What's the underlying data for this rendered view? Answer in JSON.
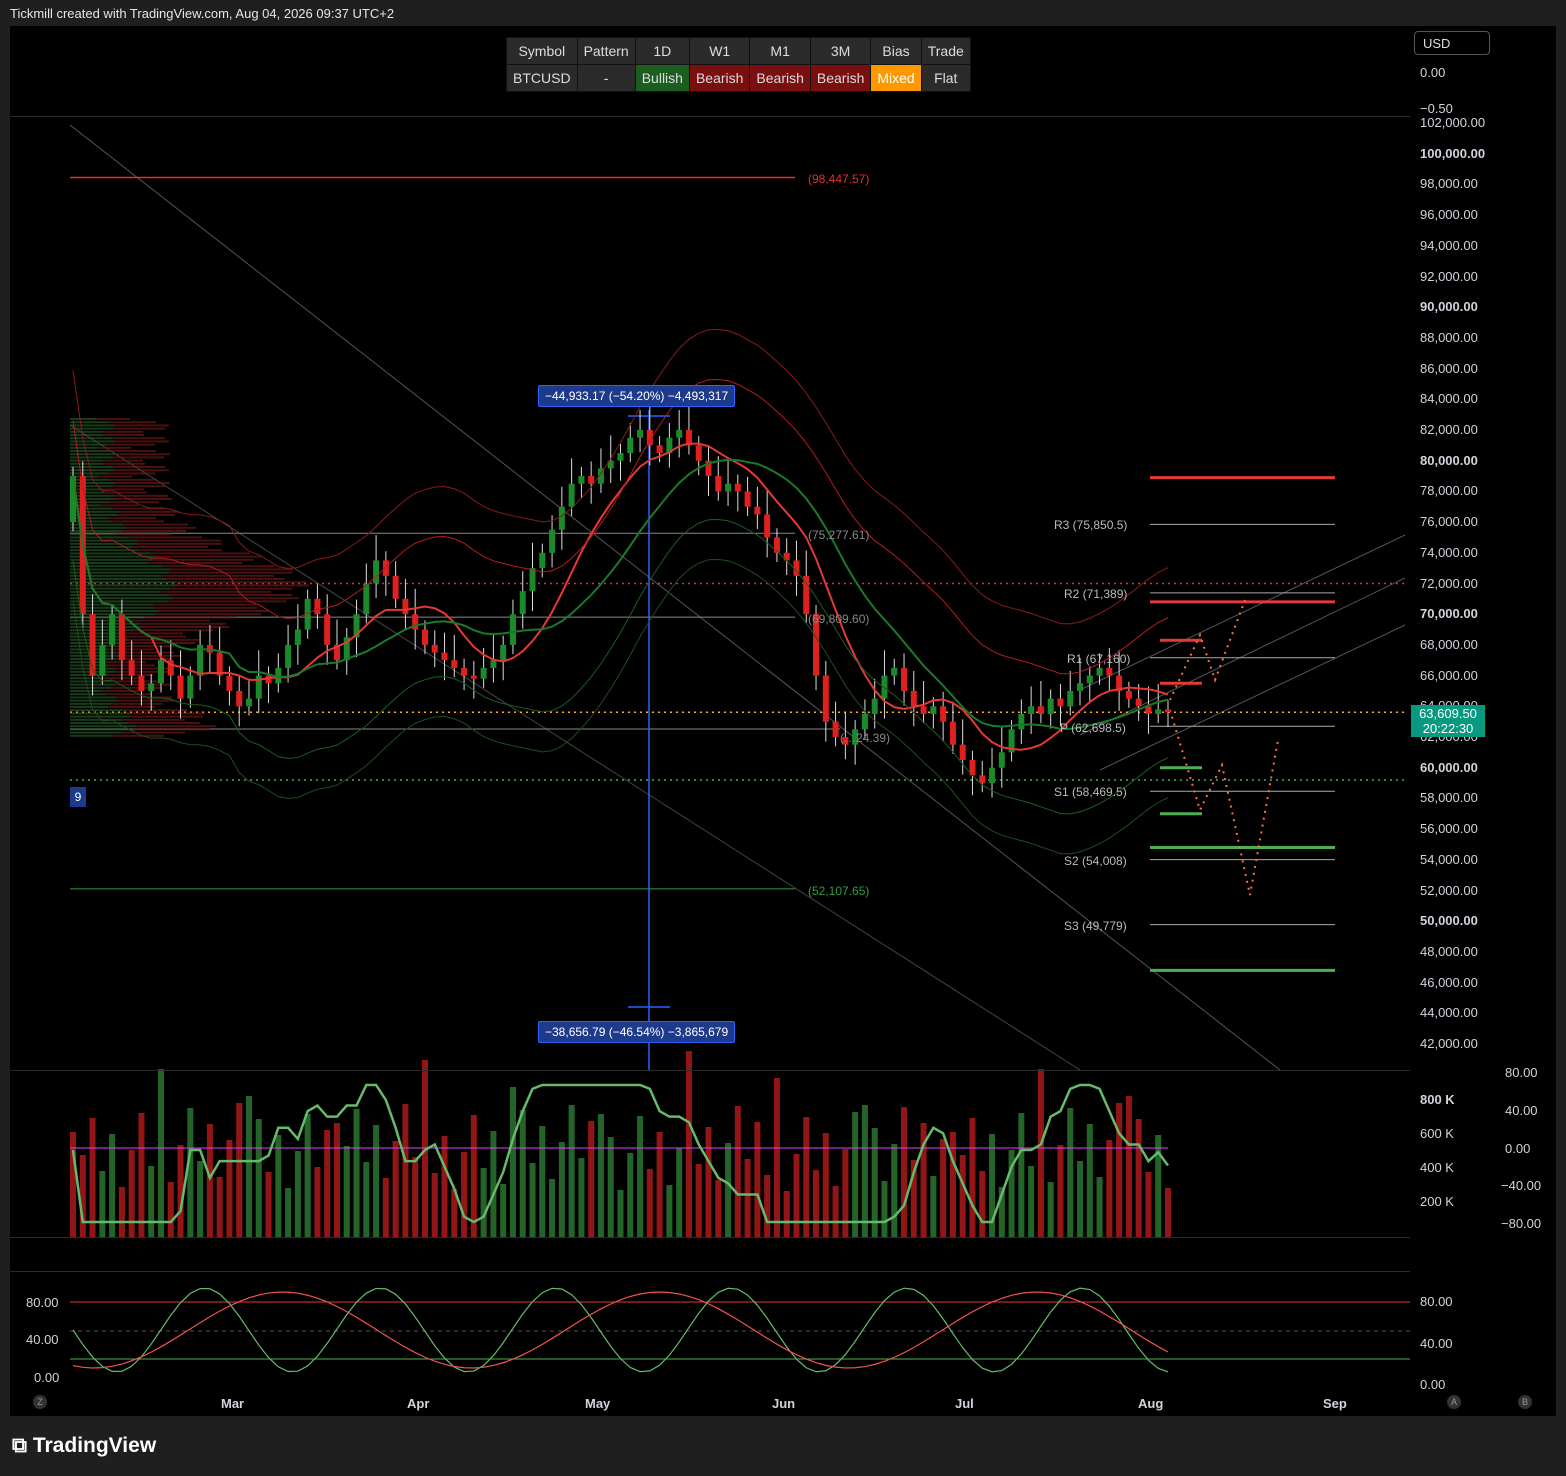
{
  "header": {
    "text": "Tickmill created with TradingView.com, Aug 04, 2026 09:37 UTC+2"
  },
  "summary_table": {
    "headers": [
      "Symbol",
      "Pattern",
      "1D",
      "W1",
      "M1",
      "3M",
      "Bias",
      "Trade"
    ],
    "values": [
      "BTCUSD",
      "-",
      "Bullish",
      "Bearish",
      "Bearish",
      "Bearish",
      "Mixed",
      "Flat"
    ]
  },
  "currency": "USD",
  "colors": {
    "up": "#1a8a2a",
    "down": "#e01f1f",
    "accent": "#2962ff",
    "bias_mixed": "#ff9800",
    "price_box": "#089981"
  },
  "price_axis": {
    "ticks": [
      "0.00",
      "−0.50",
      "102,000.00",
      "100,000.00",
      "98,000.00",
      "96,000.00",
      "94,000.00",
      "92,000.00",
      "90,000.00",
      "88,000.00",
      "86,000.00",
      "84,000.00",
      "82,000.00",
      "80,000.00",
      "78,000.00",
      "76,000.00",
      "74,000.00",
      "72,000.00",
      "70,000.00",
      "68,000.00",
      "66,000.00",
      "64,000.00",
      "62,000.00",
      "60,000.00",
      "58,000.00",
      "56,000.00",
      "54,000.00",
      "52,000.00",
      "50,000.00",
      "48,000.00",
      "46,000.00",
      "44,000.00",
      "42,000.00"
    ],
    "last_price": "63,609.50",
    "countdown": "20:22:30"
  },
  "volume_axis": {
    "left": [
      "800 K",
      "600 K",
      "400 K",
      "200 K"
    ],
    "right": [
      "80.00",
      "40.00",
      "0.00",
      "−40.00",
      "−80.00"
    ]
  },
  "osc_axis": {
    "left": [
      "80.00",
      "40.00",
      "0.00"
    ],
    "right": [
      "80.00",
      "40.00",
      "0.00"
    ]
  },
  "time_axis": [
    "Mar",
    "Apr",
    "May",
    "Jun",
    "Jul",
    "Aug",
    "Sep"
  ],
  "levels": {
    "high_line": "(98,447.57)",
    "l1": "(75,277.61)",
    "l2": "(69,809.60)",
    "l3": "(…24.39)",
    "low_line": "(52,107.65)",
    "R3": "R3 (75,850.5)",
    "R2": "R2 (71,389)",
    "R1": "R1 (67,160)",
    "P": "P (62,698.5)",
    "S1": "S1 (58,469.5)",
    "S2": "S2 (54,008)",
    "S3": "S3 (49,779)",
    "left_tag": "9"
  },
  "measure": {
    "top": "−44,933.17 (−54.20%) −4,493,317",
    "bottom": "−38,656.79 (−46.54%) −3,865,679"
  },
  "footer": {
    "logo": "TradingView",
    "btn_z": "Z",
    "btn_a": "A",
    "btn_b": "B"
  },
  "chart_data": {
    "type": "candlestick",
    "symbol": "BTCUSD",
    "timeframe": "1D",
    "x_range": [
      "2026-02-05",
      "2026-09-05"
    ],
    "ylim": [
      41000,
      103000
    ],
    "closes": [
      79000,
      70000,
      66000,
      68000,
      70000,
      67000,
      66000,
      65000,
      65500,
      67000,
      66000,
      64500,
      66000,
      68000,
      67500,
      66000,
      65000,
      64000,
      64500,
      66000,
      65500,
      66500,
      68000,
      69000,
      71000,
      70000,
      68000,
      67000,
      68500,
      70000,
      72000,
      73500,
      72500,
      71000,
      70000,
      69000,
      68000,
      67500,
      67000,
      66500,
      66000,
      65800,
      66500,
      67000,
      68000,
      70000,
      71500,
      73000,
      74000,
      75500,
      77000,
      78500,
      79000,
      78500,
      79500,
      80000,
      80500,
      81500,
      82000,
      81000,
      80500,
      81500,
      82000,
      81000,
      80000,
      79000,
      78000,
      78500,
      78000,
      77000,
      76500,
      75000,
      74000,
      73500,
      72500,
      70000,
      66000,
      63000,
      62000,
      61500,
      62500,
      63500,
      64500,
      66000,
      66500,
      65000,
      64000,
      63500,
      64000,
      63000,
      61500,
      60500,
      59500,
      59000,
      60000,
      61000,
      62500,
      63500,
      64000,
      63500,
      64500,
      64000,
      65000,
      65500,
      66000,
      66500,
      66000,
      65000,
      64500,
      64000,
      63500,
      63800,
      63609.5
    ],
    "pivots": {
      "R3": 75850.5,
      "R2": 71389,
      "R1": 67160,
      "P": 62698.5,
      "S1": 58469.5,
      "S2": 54008,
      "S3": 49779
    },
    "horizontal_levels": [
      98447.57,
      75277.61,
      69809.6,
      52107.65
    ],
    "last_price": 63609.5
  }
}
